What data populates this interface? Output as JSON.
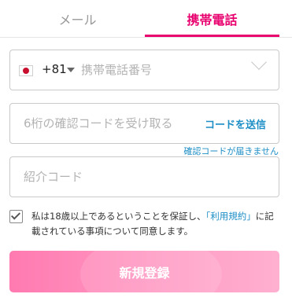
{
  "tabs": {
    "email_label": "メール",
    "phone_label": "携帯電話"
  },
  "phone": {
    "country_code": "+81",
    "placeholder": "携帯電話番号"
  },
  "verification": {
    "placeholder": "6桁の確認コードを受け取る",
    "send_label": "コードを送信",
    "not_received_label": "確認コードが届きません"
  },
  "invite": {
    "placeholder": "紹介コード"
  },
  "agreement": {
    "checked": true,
    "text_before": "私は18歳以上であるということを保証し、",
    "terms_link": "「利用規約」",
    "text_after": "に記載されている事項について同意します。"
  },
  "register": {
    "label": "新規登録"
  },
  "colors": {
    "accent": "#e8006f",
    "link": "#1d8ec6",
    "button_gradient_start": "#ff7ab0",
    "button_gradient_end": "#ffb0d0"
  },
  "icons": {
    "country_flag": "japan-flag-icon",
    "country_dropdown": "caret-down-icon",
    "field_chevron": "chevron-down-icon",
    "agree_checkbox": "checkmark-icon"
  }
}
